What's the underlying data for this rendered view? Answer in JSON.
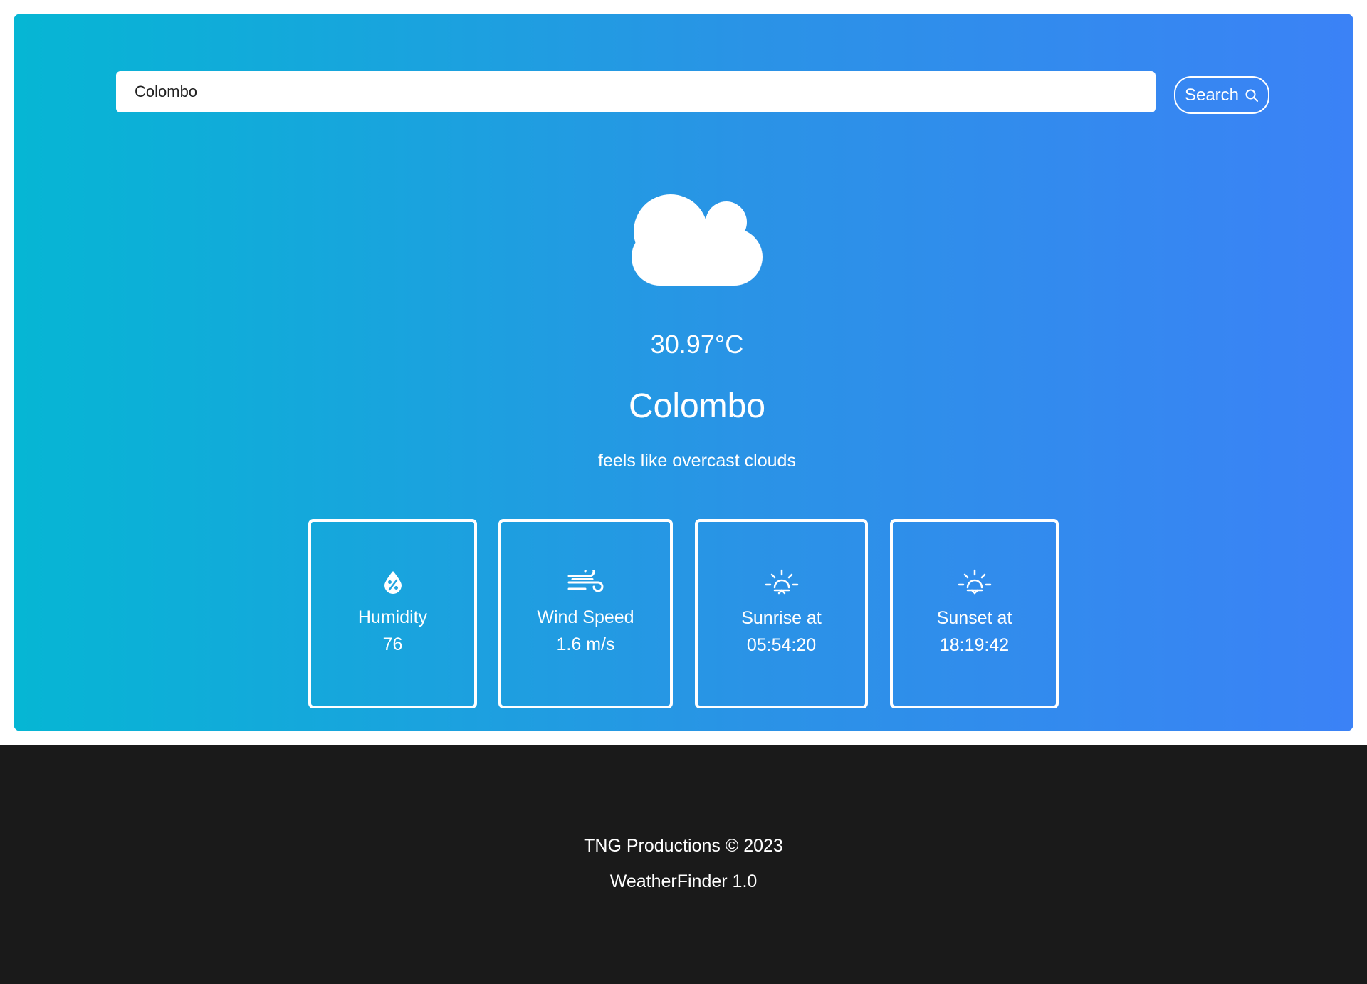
{
  "search": {
    "value": "Colombo",
    "button_label": "Search",
    "icon": "search-icon"
  },
  "weather": {
    "icon": "cloud-icon",
    "temperature": "30.97°C",
    "city": "Colombo",
    "description": "feels like overcast clouds"
  },
  "stats": [
    {
      "icon": "humidity-icon",
      "label": "Humidity",
      "value": "76"
    },
    {
      "icon": "wind-icon",
      "label": "Wind Speed",
      "value": "1.6 m/s"
    },
    {
      "icon": "sunrise-icon",
      "label": "Sunrise at",
      "value": "05:54:20"
    },
    {
      "icon": "sunset-icon",
      "label": "Sunset at",
      "value": "18:19:42"
    }
  ],
  "footer": {
    "copyright": "TNG Productions © 2023",
    "app_version": "WeatherFinder 1.0"
  },
  "colors": {
    "gradient_start": "#06b6d4",
    "gradient_end": "#3b82f6",
    "footer_background": "#1a1a1a",
    "text": "#ffffff"
  }
}
